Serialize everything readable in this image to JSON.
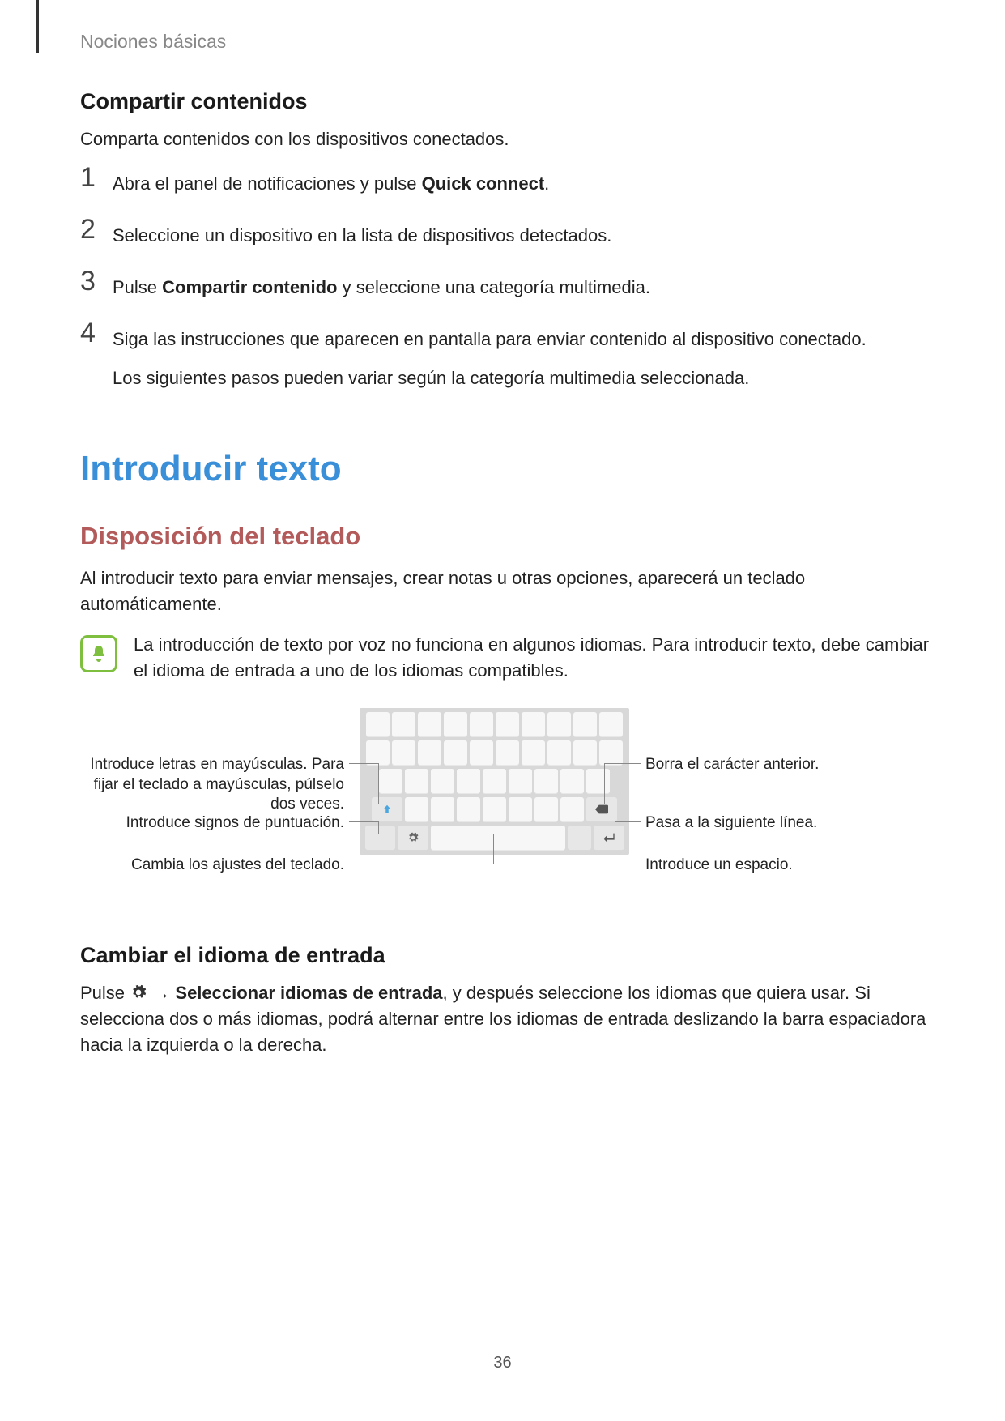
{
  "header": "Nociones básicas",
  "section1": {
    "title": "Compartir contenidos",
    "intro": "Comparta contenidos con los dispositivos conectados."
  },
  "steps": {
    "s1": {
      "n": "1",
      "a": "Abra el panel de notificaciones y pulse ",
      "b": "Quick connect",
      "c": "."
    },
    "s2": {
      "n": "2",
      "t": "Seleccione un dispositivo en la lista de dispositivos detectados."
    },
    "s3": {
      "n": "3",
      "a": "Pulse ",
      "b": "Compartir contenido",
      "c": " y seleccione una categoría multimedia."
    },
    "s4": {
      "n": "4",
      "t1": "Siga las instrucciones que aparecen en pantalla para enviar contenido al dispositivo conectado.",
      "t2": "Los siguientes pasos pueden variar según la categoría multimedia seleccionada."
    }
  },
  "h1": "Introducir texto",
  "h2": "Disposición del teclado",
  "intro2": "Al introducir texto para enviar mensajes, crear notas u otras opciones, aparecerá un teclado automáticamente.",
  "note": "La introducción de texto por voz no funciona en algunos idiomas. Para introducir texto, debe cambiar el idioma de entrada a uno de los idiomas compatibles.",
  "kbd_labels": {
    "l1": "Introduce letras en mayúsculas. Para fijar el teclado a mayúsculas, púlselo dos veces.",
    "l2": "Introduce signos de puntuación.",
    "l3": "Cambia los ajustes del teclado.",
    "r1": "Borra el carácter anterior.",
    "r2": "Pasa a la siguiente línea.",
    "r3": "Introduce un espacio."
  },
  "section3": {
    "title": "Cambiar el idioma de entrada",
    "a": "Pulse ",
    "arrow": " → ",
    "b": "Seleccionar idiomas de entrada",
    "c": ", y después seleccione los idiomas que quiera usar. Si selecciona dos o más idiomas, podrá alternar entre los idiomas de entrada deslizando la barra espaciadora hacia la izquierda o la derecha."
  },
  "icons": {
    "bell": "bell-icon",
    "gear": "gear-icon",
    "shift": "shift-icon",
    "backspace": "backspace-icon",
    "enter": "enter-icon"
  },
  "page_number": "36"
}
